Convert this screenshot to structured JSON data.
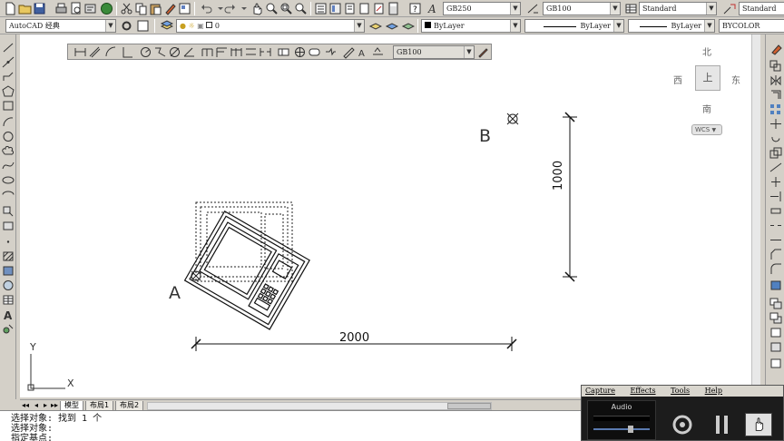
{
  "toolbar_top": {
    "text_style": "GB250",
    "dim_style": "GB100",
    "table_style": "Standard",
    "multileader_style": "Standard"
  },
  "toolbar_second": {
    "workspace": "AutoCAD 经典",
    "layer": "0",
    "color": "ByLayer",
    "linetype": "ByLayer",
    "lineweight": "ByLayer",
    "plotstyle": "BYCOLOR"
  },
  "dim_toolbar": {
    "style_combo": "GB100"
  },
  "viewcube": {
    "north": "北",
    "south": "南",
    "east": "东",
    "west": "西",
    "face": "上",
    "wcs": "WCS"
  },
  "drawing": {
    "point_a": "A",
    "point_b": "B",
    "horizontal_dim": "2000",
    "vertical_dim": "1000",
    "ucs_x": "X",
    "ucs_y": "Y"
  },
  "layout_tabs": [
    "模型",
    "布局1",
    "布局2"
  ],
  "command_lines": [
    "选择对象: 找到 1 个",
    "选择对象:",
    "指定基点:"
  ],
  "capture_widget": {
    "menu": [
      "Capture",
      "Effects",
      "Tools",
      "Help"
    ],
    "audio_label": "Audio"
  },
  "icons": [
    "new-icon",
    "open-icon",
    "save-icon",
    "print-icon",
    "undo-icon",
    "redo-icon",
    "pan-icon",
    "zoom-icon",
    "properties-icon",
    "help-icon",
    "line-icon",
    "circle-icon",
    "arc-icon",
    "hatch-icon",
    "text-icon"
  ]
}
